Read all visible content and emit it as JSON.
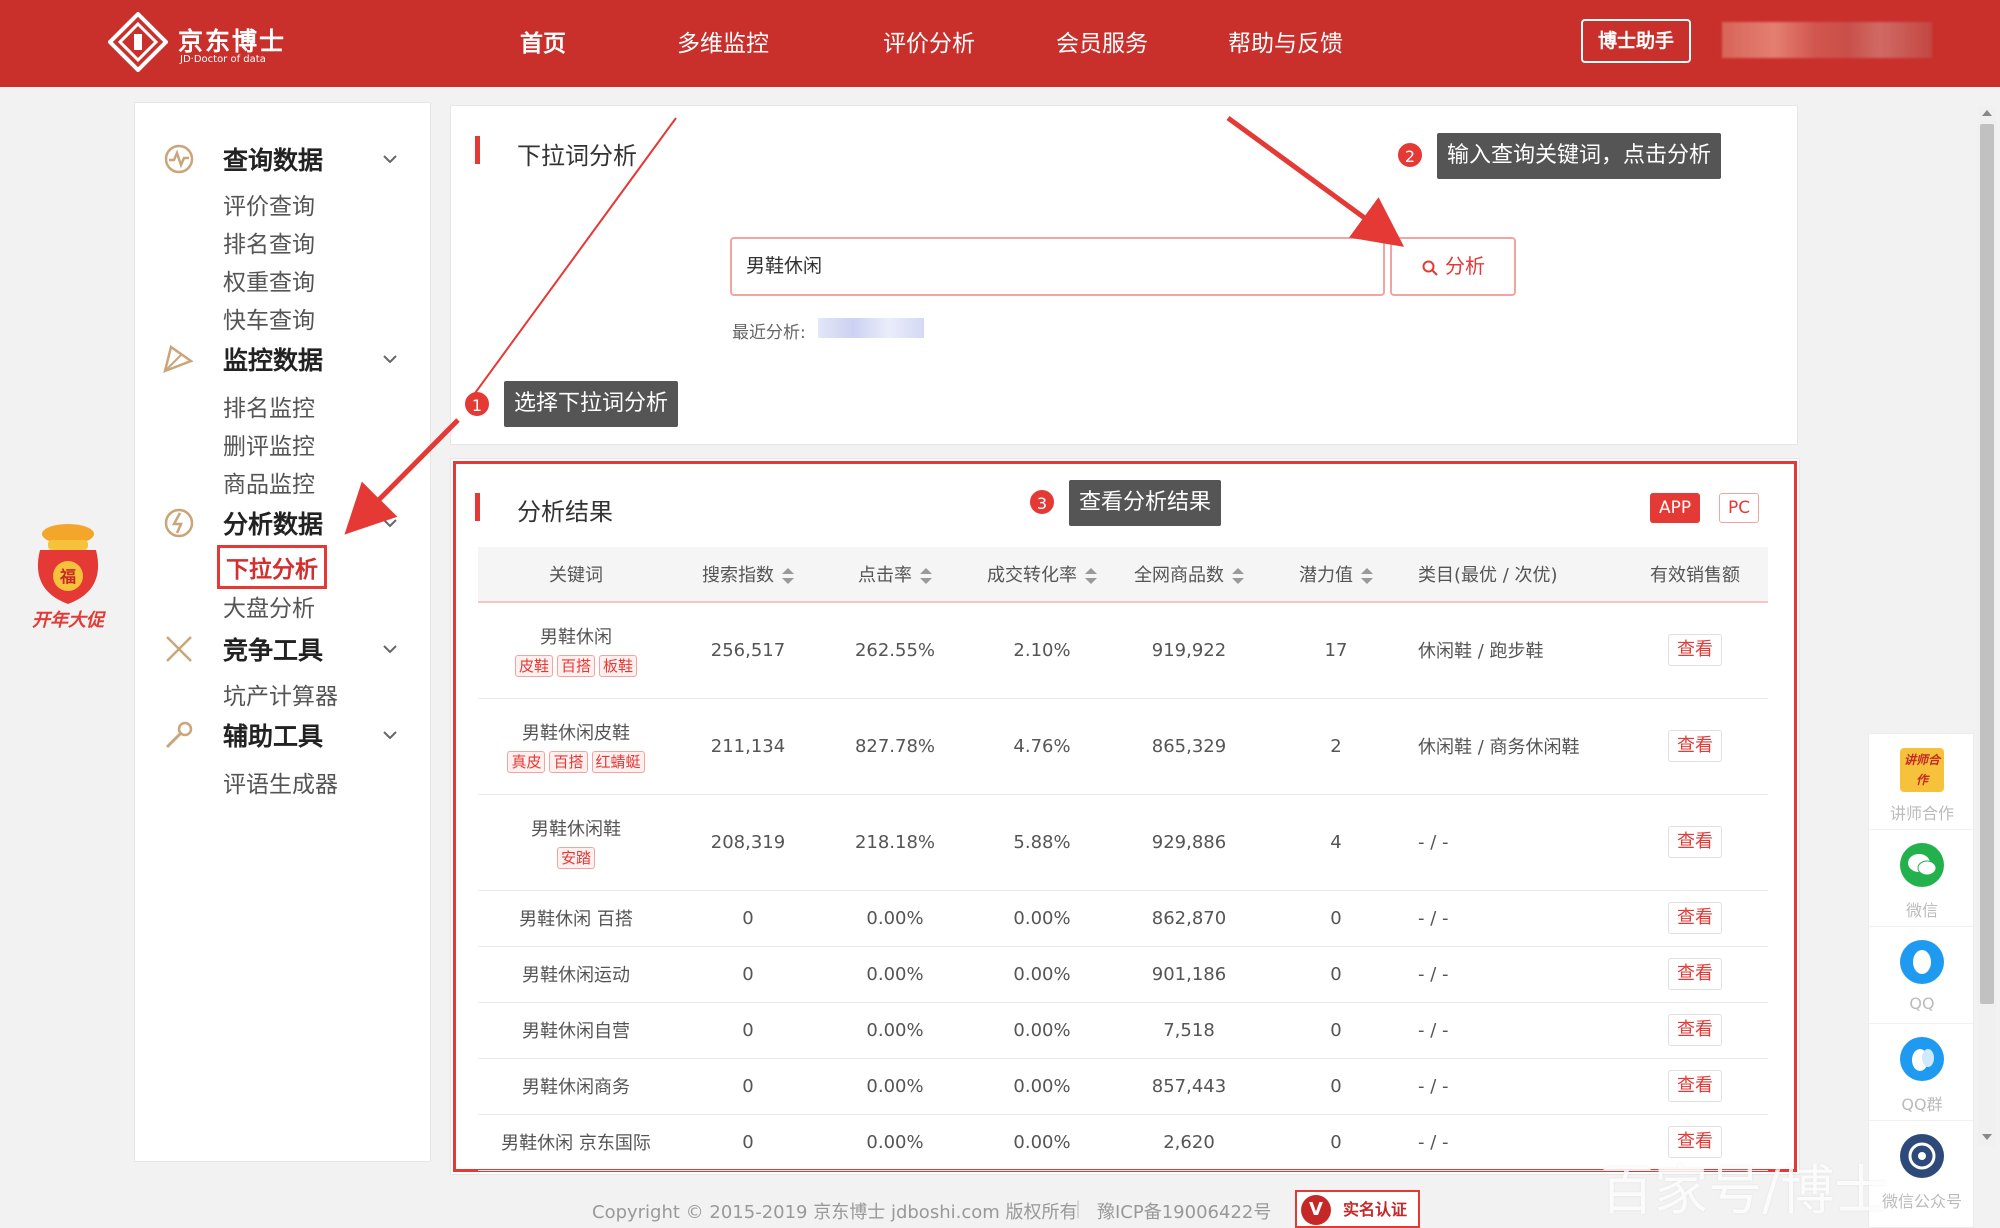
{
  "header": {
    "logo_title": "京东博士",
    "logo_sub": "JD·Doctor of data",
    "nav": [
      "首页",
      "多维监控",
      "评价分析",
      "会员服务",
      "帮助与反馈"
    ],
    "assistant_label": "博士助手",
    "brand_color": "#c9302c"
  },
  "sidebar": {
    "groups": [
      {
        "title": "查询数据",
        "icon": "chart-query-icon",
        "items": [
          "评价查询",
          "排名查询",
          "权重查询",
          "快车查询"
        ]
      },
      {
        "title": "监控数据",
        "icon": "monitor-icon",
        "items": [
          "排名监控",
          "删评监控",
          "商品监控"
        ]
      },
      {
        "title": "分析数据",
        "icon": "analysis-icon",
        "items": [
          "下拉分析",
          "大盘分析"
        ]
      },
      {
        "title": "竞争工具",
        "icon": "swords-icon",
        "items": [
          "坑产计算器"
        ]
      },
      {
        "title": "辅助工具",
        "icon": "wrench-icon",
        "items": [
          "评语生成器"
        ]
      }
    ]
  },
  "promo": {
    "bag_char": "福",
    "label": "开年大促"
  },
  "search_card": {
    "title": "下拉词分析",
    "input_value": "男鞋休闲",
    "button_label": "分析",
    "recent_label": "最近分析:"
  },
  "callouts": [
    {
      "num": "1",
      "text": "选择下拉词分析"
    },
    {
      "num": "2",
      "text": "输入查询关键词，点击分析"
    },
    {
      "num": "3",
      "text": "查看分析结果"
    }
  ],
  "results": {
    "title": "分析结果",
    "tabs": [
      "APP",
      "PC"
    ],
    "columns": [
      "关键词",
      "搜索指数",
      "点击率",
      "成交转化率",
      "全网商品数",
      "潜力值",
      "类目(最优 / 次优)",
      "有效销售额"
    ],
    "view_label": "查看",
    "rows": [
      {
        "keyword": "男鞋休闲",
        "tags": [
          "皮鞋",
          "百搭",
          "板鞋"
        ],
        "search_index": "256,517",
        "ctr": "262.55%",
        "cvr": "2.10%",
        "products": "919,922",
        "potential": "17",
        "category": "休闲鞋 / 跑步鞋"
      },
      {
        "keyword": "男鞋休闲皮鞋",
        "tags": [
          "真皮",
          "百搭",
          "红蜻蜓"
        ],
        "search_index": "211,134",
        "ctr": "827.78%",
        "cvr": "4.76%",
        "products": "865,329",
        "potential": "2",
        "category": "休闲鞋 / 商务休闲鞋"
      },
      {
        "keyword": "男鞋休闲鞋",
        "tags": [
          "安踏"
        ],
        "search_index": "208,319",
        "ctr": "218.18%",
        "cvr": "5.88%",
        "products": "929,886",
        "potential": "4",
        "category": "- / -"
      },
      {
        "keyword": "男鞋休闲 百搭",
        "tags": [],
        "search_index": "0",
        "ctr": "0.00%",
        "cvr": "0.00%",
        "products": "862,870",
        "potential": "0",
        "category": "- / -"
      },
      {
        "keyword": "男鞋休闲运动",
        "tags": [],
        "search_index": "0",
        "ctr": "0.00%",
        "cvr": "0.00%",
        "products": "901,186",
        "potential": "0",
        "category": "- / -"
      },
      {
        "keyword": "男鞋休闲自营",
        "tags": [],
        "search_index": "0",
        "ctr": "0.00%",
        "cvr": "0.00%",
        "products": "7,518",
        "potential": "0",
        "category": "- / -"
      },
      {
        "keyword": "男鞋休闲商务",
        "tags": [],
        "search_index": "0",
        "ctr": "0.00%",
        "cvr": "0.00%",
        "products": "857,443",
        "potential": "0",
        "category": "- / -"
      },
      {
        "keyword": "男鞋休闲 京东国际",
        "tags": [],
        "search_index": "0",
        "ctr": "0.00%",
        "cvr": "0.00%",
        "products": "2,620",
        "potential": "0",
        "category": "- / -"
      }
    ]
  },
  "footer": {
    "copyright": "Copyright © 2015-2019 京东博士 jdboshi.com 版权所有",
    "separator": "|",
    "icp": "豫ICP备19006422号",
    "auth_badge": "实名认证",
    "auth_v": "V"
  },
  "float_bar": [
    {
      "label": "讲师合作",
      "icon": "lecturer-icon",
      "badge": "讲师合作"
    },
    {
      "label": "微信",
      "icon": "wechat-icon"
    },
    {
      "label": "QQ",
      "icon": "qq-icon"
    },
    {
      "label": "QQ群",
      "icon": "qq-group-icon"
    },
    {
      "label": "微信公众号",
      "icon": "wechat-official-icon"
    }
  ],
  "watermark": "百家号/博士"
}
